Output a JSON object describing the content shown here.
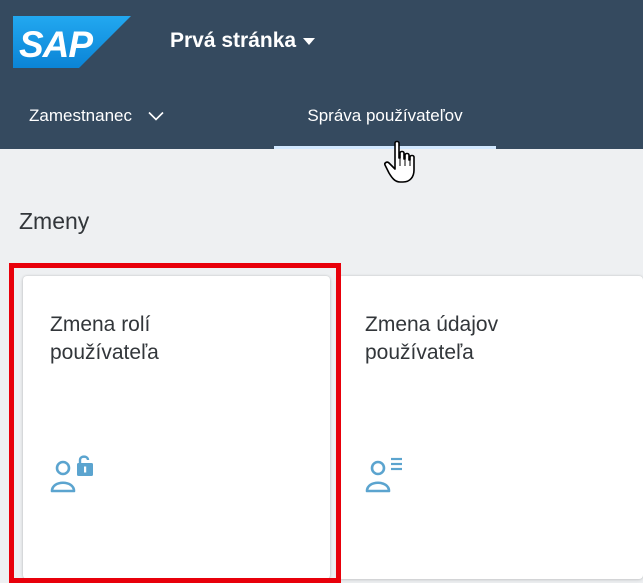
{
  "brand": {
    "logo_text": "SAP",
    "logo_color": "#1a9be5",
    "logo_text_color": "#ffffff"
  },
  "header": {
    "page_title": "Prvá stránka",
    "background_color": "#354a5f"
  },
  "tabs": [
    {
      "label": "Zamestnanec",
      "has_dropdown": true,
      "selected": false
    },
    {
      "label": "Správa používateľov",
      "has_dropdown": false,
      "selected": true
    }
  ],
  "section": {
    "title": "Zmeny"
  },
  "tiles": [
    {
      "title_line1": "Zmena rolí",
      "title_line2": "používateľa",
      "icon": "user-unlock-icon",
      "highlighted": true
    },
    {
      "title_line1": "Zmena údajov",
      "title_line2": "používateľa",
      "icon": "user-details-icon",
      "highlighted": false
    }
  ],
  "colors": {
    "icon_color": "#5ba4cf",
    "highlight_color": "#e8000b",
    "tab_indicator": "#d1e8ff"
  },
  "cursor": "hand-pointer-icon"
}
